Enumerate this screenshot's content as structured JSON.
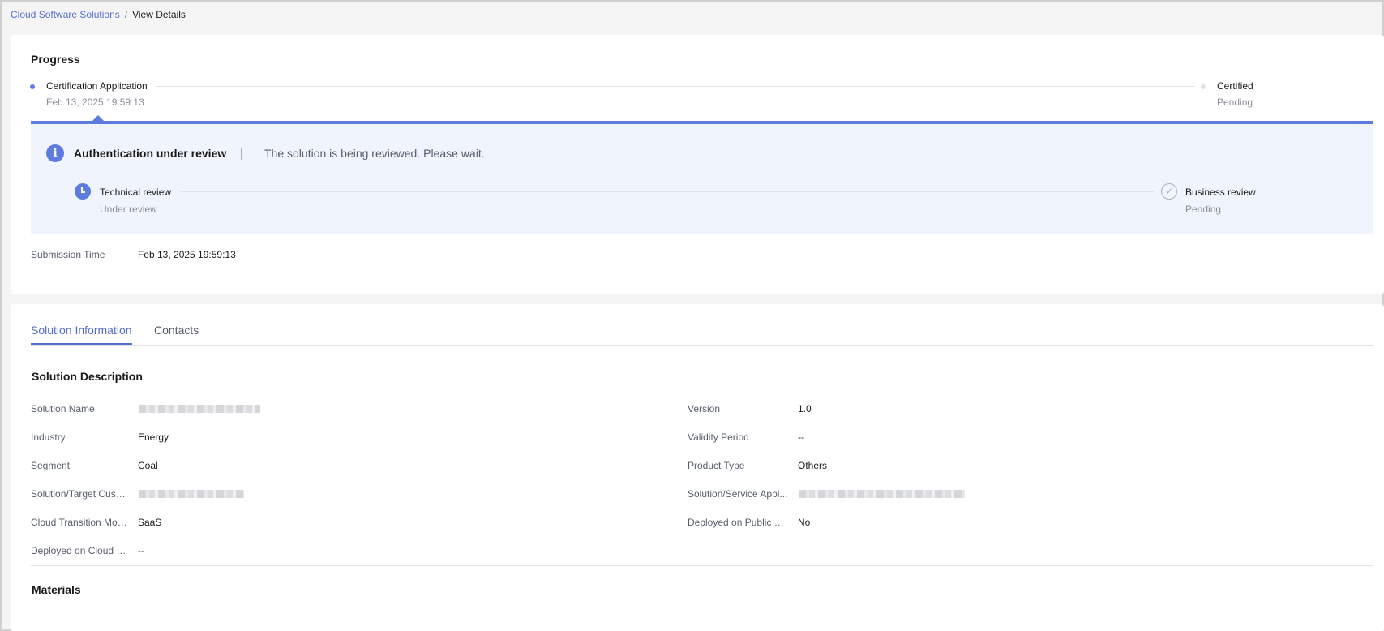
{
  "breadcrumb": {
    "parent": "Cloud Software Solutions",
    "separator": "/",
    "current": "View Details"
  },
  "progress": {
    "title": "Progress",
    "steps": [
      {
        "title": "Certification Application",
        "sub": "Feb 13, 2025 19:59:13"
      },
      {
        "title": "Certified",
        "sub": "Pending"
      }
    ],
    "review": {
      "title": "Authentication under review",
      "message": "The solution is being reviewed. Please wait.",
      "substeps": [
        {
          "title": "Technical review",
          "status": "Under review"
        },
        {
          "title": "Business review",
          "status": "Pending"
        }
      ]
    },
    "submission": {
      "label": "Submission Time",
      "value": "Feb 13, 2025 19:59:13"
    }
  },
  "tabs": [
    {
      "label": "Solution Information",
      "active": true
    },
    {
      "label": "Contacts",
      "active": false
    }
  ],
  "solution_description": {
    "title": "Solution Description",
    "left": [
      {
        "label": "Solution Name",
        "value": ""
      },
      {
        "label": "Industry",
        "value": "Energy"
      },
      {
        "label": "Segment",
        "value": "Coal"
      },
      {
        "label": "Solution/Target Custo...",
        "value": ""
      },
      {
        "label": "Cloud Transition Mode",
        "value": "SaaS"
      },
      {
        "label": "Deployed on Cloud P...",
        "value": "--"
      }
    ],
    "right": [
      {
        "label": "Version",
        "value": "1.0"
      },
      {
        "label": "Validity Period",
        "value": "--"
      },
      {
        "label": "Product Type",
        "value": "Others"
      },
      {
        "label": "Solution/Service Appl...",
        "value": ""
      },
      {
        "label": "Deployed on Public C...",
        "value": "No"
      }
    ]
  },
  "materials": {
    "title": "Materials"
  },
  "colors": {
    "accent": "#5e7ce0",
    "link": "#526ecc",
    "panel": "#f0f4fc"
  }
}
